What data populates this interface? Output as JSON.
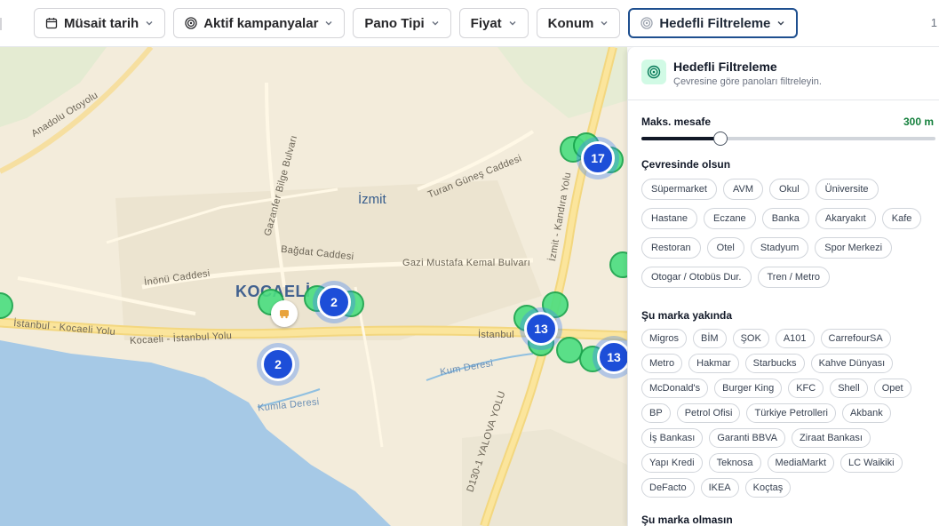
{
  "toolbar": {
    "filters": [
      {
        "label": "Müsait tarih",
        "icon": "calendar-icon"
      },
      {
        "label": "Aktif kampanyalar",
        "icon": "target-icon"
      },
      {
        "label": "Pano Tipi"
      },
      {
        "label": "Fiyat"
      },
      {
        "label": "Konum"
      },
      {
        "label": "Hedefli Filtreleme",
        "icon": "target-icon",
        "active": true
      }
    ],
    "edge_text": "1"
  },
  "map": {
    "city": "İzmit",
    "region": "KOCAELİ",
    "streets": [
      "Anadolu Otoyolu",
      "Gazanfer Bilge Bulvarı",
      "Turan Güneş Caddesi",
      "Bağdat Caddesi",
      "Gazi Mustafa Kemal Bulvarı",
      "İnönü Caddesi",
      "İstanbul - Kocaeli Yolu",
      "Kocaeli - İstanbul Yolu",
      "İstanbul",
      "Kum Deresi",
      "Kumla Deresi",
      "D130-1 YALOVA YOLU",
      "İzmit - Kandıra Yolu"
    ],
    "clusters": [
      "17",
      "2",
      "13",
      "2",
      "13"
    ]
  },
  "panel": {
    "title": "Hedefli Filtreleme",
    "subtitle": "Çevresine göre panoları filtreleyin.",
    "distance": {
      "label": "Maks. mesafe",
      "value": "300 m",
      "fraction": 0.27
    },
    "around": {
      "label": "Çevresinde olsun",
      "items": [
        "Süpermarket",
        "AVM",
        "Okul",
        "Üniversite",
        "Hastane",
        "Eczane",
        "Banka",
        "Akaryakıt",
        "Kafe",
        "Restoran",
        "Otel",
        "Stadyum",
        "Spor Merkezi",
        "Otogar / Otobüs Dur.",
        "Tren / Metro"
      ]
    },
    "brand_near": {
      "label": "Şu marka yakında",
      "items": [
        "Migros",
        "BİM",
        "ŞOK",
        "A101",
        "CarrefourSA",
        "Metro",
        "Hakmar",
        "Starbucks",
        "Kahve Dünyası",
        "McDonald's",
        "Burger King",
        "KFC",
        "Shell",
        "Opet",
        "BP",
        "Petrol Ofisi",
        "Türkiye Petrolleri",
        "Akbank",
        "İş Bankası",
        "Garanti BBVA",
        "Ziraat Bankası",
        "Yapı Kredi",
        "Teknosa",
        "MediaMarkt",
        "LC Waikiki",
        "DeFacto",
        "IKEA",
        "Koçtaş"
      ]
    },
    "brand_not": {
      "label": "Şu marka olmasın"
    }
  },
  "colors": {
    "accent": "#1e4f8f",
    "cluster": "#1d4ed8",
    "pin": "#4ade80",
    "distance": "#15803d"
  }
}
